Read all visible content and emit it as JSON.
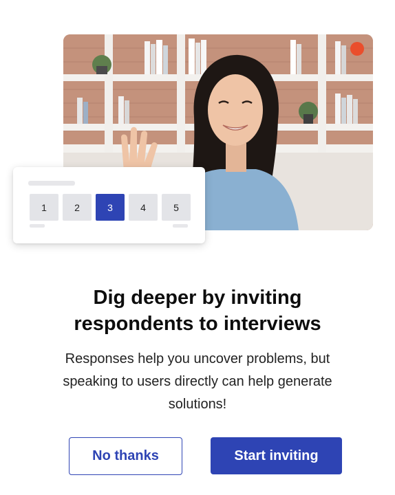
{
  "illustration": {
    "scale_options": [
      "1",
      "2",
      "3",
      "4",
      "5"
    ],
    "selected_option": "3"
  },
  "colors": {
    "accent": "#2e44b4",
    "record_dot": "#ea4e2c",
    "scale_option_bg": "#e3e4e8"
  },
  "content": {
    "heading_line1": "Dig deeper by inviting",
    "heading_line2": "respondents to interviews",
    "description_line1": "Responses help you uncover problems, but",
    "description_line2": "speaking to users directly can help generate",
    "description_line3": "solutions!"
  },
  "actions": {
    "secondary_label": "No thanks",
    "primary_label": "Start inviting"
  }
}
